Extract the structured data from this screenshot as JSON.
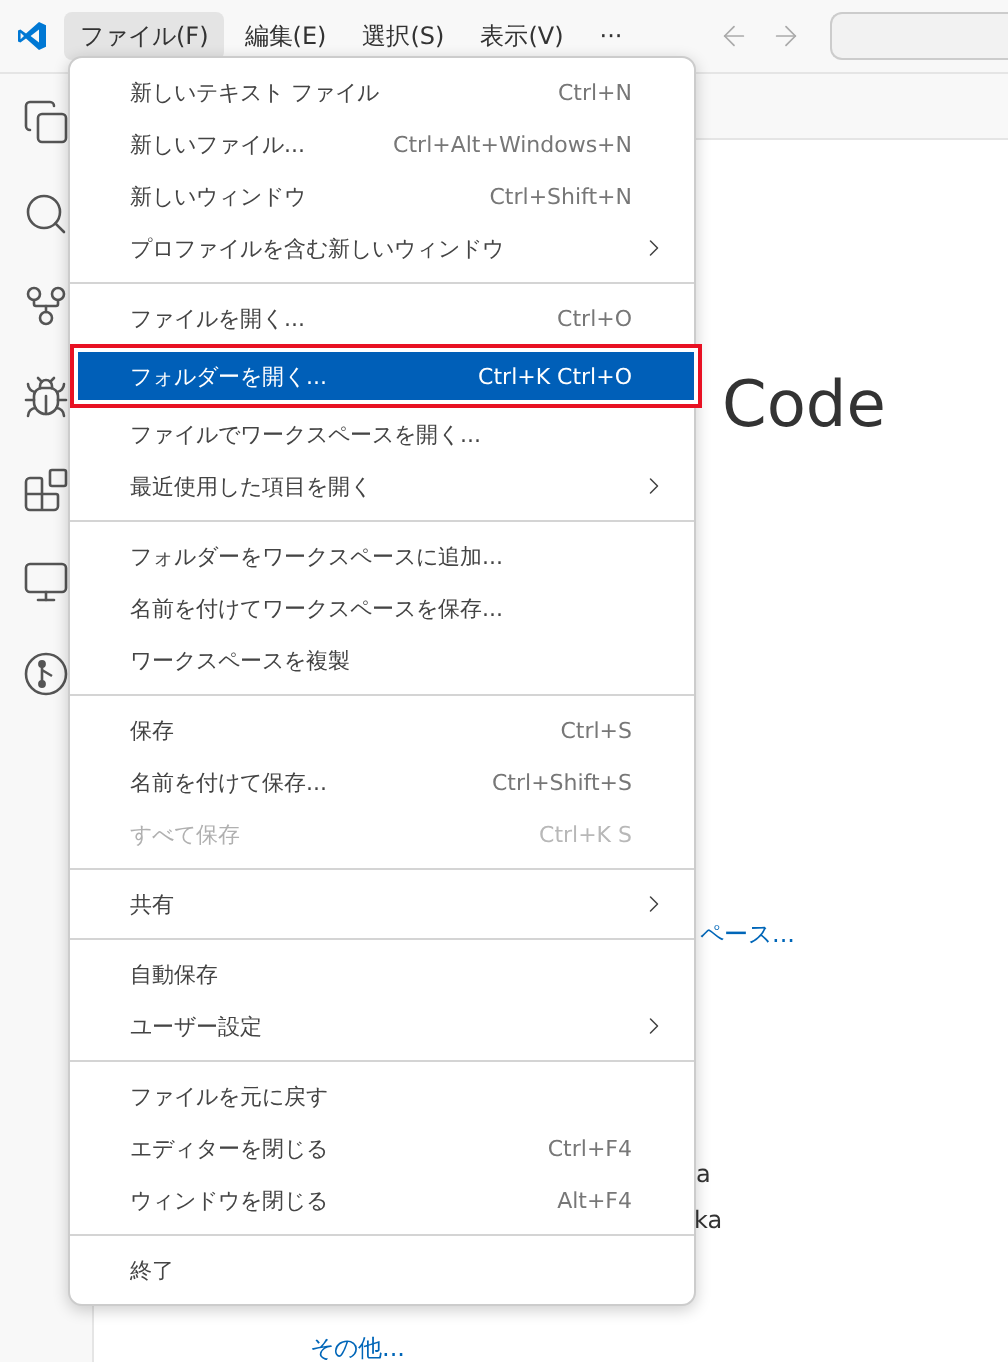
{
  "menubar": [
    {
      "label": "ファイル(F)",
      "selected": true
    },
    {
      "label": "編集(E)",
      "selected": false
    },
    {
      "label": "選択(S)",
      "selected": false
    },
    {
      "label": "表示(V)",
      "selected": false
    },
    {
      "label": "···",
      "selected": false
    }
  ],
  "editor": {
    "title": "Code",
    "link_1": "ペース...",
    "text_1": "a",
    "text_2": "ka",
    "link_2": "その他..."
  },
  "file_menu": {
    "groups": [
      [
        {
          "label": "新しいテキスト ファイル",
          "shortcut": "Ctrl+N",
          "submenu": false,
          "disabled": false,
          "selected": false,
          "annotated": false
        },
        {
          "label": "新しいファイル...",
          "shortcut": "Ctrl+Alt+Windows+N",
          "submenu": false,
          "disabled": false,
          "selected": false,
          "annotated": false
        },
        {
          "label": "新しいウィンドウ",
          "shortcut": "Ctrl+Shift+N",
          "submenu": false,
          "disabled": false,
          "selected": false,
          "annotated": false
        },
        {
          "label": "プロファイルを含む新しいウィンドウ",
          "submenu": true,
          "disabled": false,
          "selected": false,
          "annotated": false
        }
      ],
      [
        {
          "label": "ファイルを開く...",
          "shortcut": "Ctrl+O",
          "submenu": false,
          "disabled": false,
          "selected": false,
          "annotated": false
        },
        {
          "label": "フォルダーを開く...",
          "shortcut": "Ctrl+K Ctrl+O",
          "submenu": false,
          "disabled": false,
          "selected": true,
          "annotated": true
        },
        {
          "label": "ファイルでワークスペースを開く...",
          "submenu": false,
          "disabled": false,
          "selected": false,
          "annotated": false
        },
        {
          "label": "最近使用した項目を開く",
          "submenu": true,
          "disabled": false,
          "selected": false,
          "annotated": false
        }
      ],
      [
        {
          "label": "フォルダーをワークスペースに追加...",
          "submenu": false,
          "disabled": false,
          "selected": false,
          "annotated": false
        },
        {
          "label": "名前を付けてワークスペースを保存...",
          "submenu": false,
          "disabled": false,
          "selected": false,
          "annotated": false
        },
        {
          "label": "ワークスペースを複製",
          "submenu": false,
          "disabled": false,
          "selected": false,
          "annotated": false
        }
      ],
      [
        {
          "label": "保存",
          "shortcut": "Ctrl+S",
          "submenu": false,
          "disabled": false,
          "selected": false,
          "annotated": false
        },
        {
          "label": "名前を付けて保存...",
          "shortcut": "Ctrl+Shift+S",
          "submenu": false,
          "disabled": false,
          "selected": false,
          "annotated": false
        },
        {
          "label": "すべて保存",
          "shortcut": "Ctrl+K S",
          "submenu": false,
          "disabled": true,
          "selected": false,
          "annotated": false
        }
      ],
      [
        {
          "label": "共有",
          "submenu": true,
          "disabled": false,
          "selected": false,
          "annotated": false
        }
      ],
      [
        {
          "label": "自動保存",
          "submenu": false,
          "disabled": false,
          "selected": false,
          "annotated": false
        },
        {
          "label": "ユーザー設定",
          "submenu": true,
          "disabled": false,
          "selected": false,
          "annotated": false
        }
      ],
      [
        {
          "label": "ファイルを元に戻す",
          "submenu": false,
          "disabled": false,
          "selected": false,
          "annotated": false
        },
        {
          "label": "エディターを閉じる",
          "shortcut": "Ctrl+F4",
          "submenu": false,
          "disabled": false,
          "selected": false,
          "annotated": false
        },
        {
          "label": "ウィンドウを閉じる",
          "shortcut": "Alt+F4",
          "submenu": false,
          "disabled": false,
          "selected": false,
          "annotated": false
        }
      ],
      [
        {
          "label": "終了",
          "submenu": false,
          "disabled": false,
          "selected": false,
          "annotated": false
        }
      ]
    ]
  }
}
